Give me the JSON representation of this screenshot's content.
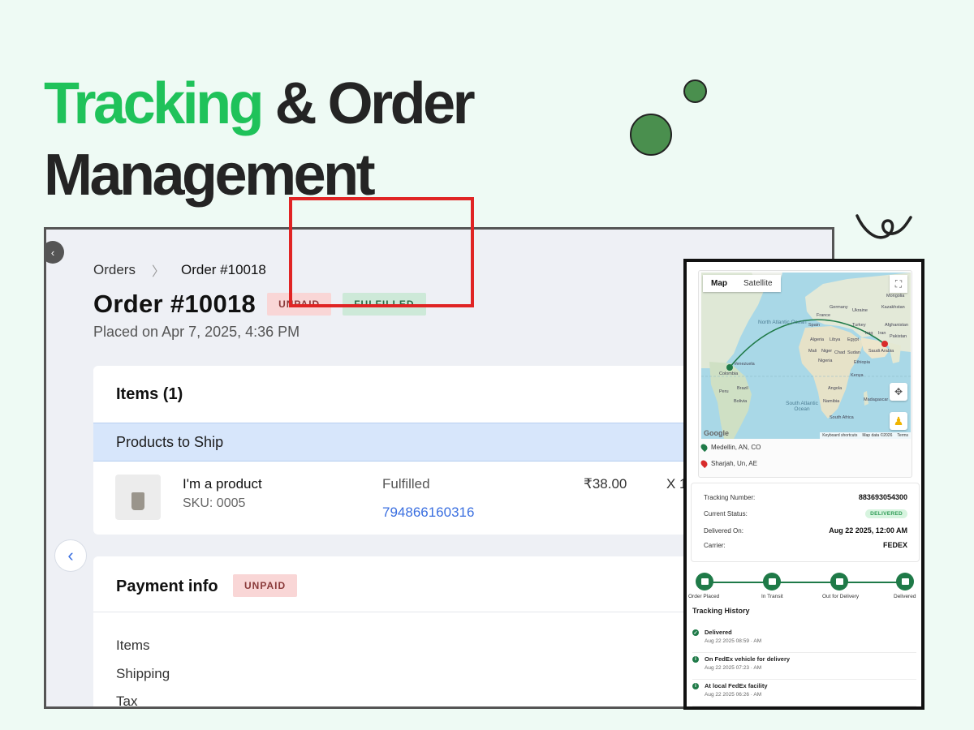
{
  "headline": {
    "highlight": "Tracking",
    "line1_rest": " & Order",
    "line2": "Management"
  },
  "order": {
    "breadcrumb_root": "Orders",
    "breadcrumb_current": "Order #10018",
    "title": "Order #10018",
    "badges": {
      "unpaid": "UNPAID",
      "fulfilled": "FULFILLED"
    },
    "placed": "Placed on Apr 7, 2025, 4:36 PM",
    "items": {
      "title": "Items (1)",
      "section": "Products to Ship",
      "product": {
        "name": "I'm a product",
        "sku": "SKU: 0005",
        "status": "Fulfilled",
        "tracking_number": "794866160316",
        "price": "₹38.00",
        "quantity": "X 1"
      }
    },
    "payment": {
      "title": "Payment info",
      "badge": "UNPAID",
      "rows": [
        "Items",
        "Shipping",
        "Tax"
      ]
    }
  },
  "widget": {
    "map": {
      "tab_map": "Map",
      "tab_satellite": "Satellite",
      "ocean_north_atlantic": "North Atlantic Ocean",
      "ocean_south_atlantic": "South Atlantic Ocean",
      "footer": [
        "Keyboard shortcuts",
        "Map data ©2026",
        "Terms"
      ],
      "google": "Google",
      "country_labels": [
        "Venezuela",
        "Colombia",
        "Brazil",
        "Peru",
        "Bolivia",
        "Algeria",
        "Libya",
        "Egypt",
        "Mali",
        "Niger",
        "Chad",
        "Sudan",
        "Nigeria",
        "Ethiopia",
        "Kenya",
        "Angola",
        "Namibia",
        "Saudi Arabia",
        "Iran",
        "Iraq",
        "Turkey",
        "Ukraine",
        "Germany",
        "Kazakhstan",
        "Afghanistan",
        "Pakistan",
        "Mongolia",
        "Madagascar",
        "South Africa",
        "France",
        "Spain"
      ]
    },
    "origin": "Medellin, AN, CO",
    "destination": "Sharjah, Un, AE",
    "info": {
      "tracking_label": "Tracking Number:",
      "tracking_value": "883693054300",
      "status_label": "Current Status:",
      "status_value": "DELIVERED",
      "delivered_label": "Delivered On:",
      "delivered_value": "Aug 22 2025, 12:00 AM",
      "carrier_label": "Carrier:",
      "carrier_value": "FEDEX"
    },
    "steps": [
      "Order Placed",
      "In Transit",
      "Out for Delivery",
      "Delivered"
    ],
    "history_title": "Tracking History",
    "history": [
      {
        "title": "Delivered",
        "time": "Aug 22 2025 08:59 · AM"
      },
      {
        "title": "On FedEx vehicle for delivery",
        "time": "Aug 22 2025 07:23 · AM"
      },
      {
        "title": "At local FedEx facility",
        "time": "Aug 22 2025 06:26 · AM"
      }
    ]
  },
  "colors": {
    "accent_green": "#1fc25a",
    "track_green": "#1f7a48",
    "link_blue": "#3a6fe0",
    "highlight_red": "#e02424"
  }
}
